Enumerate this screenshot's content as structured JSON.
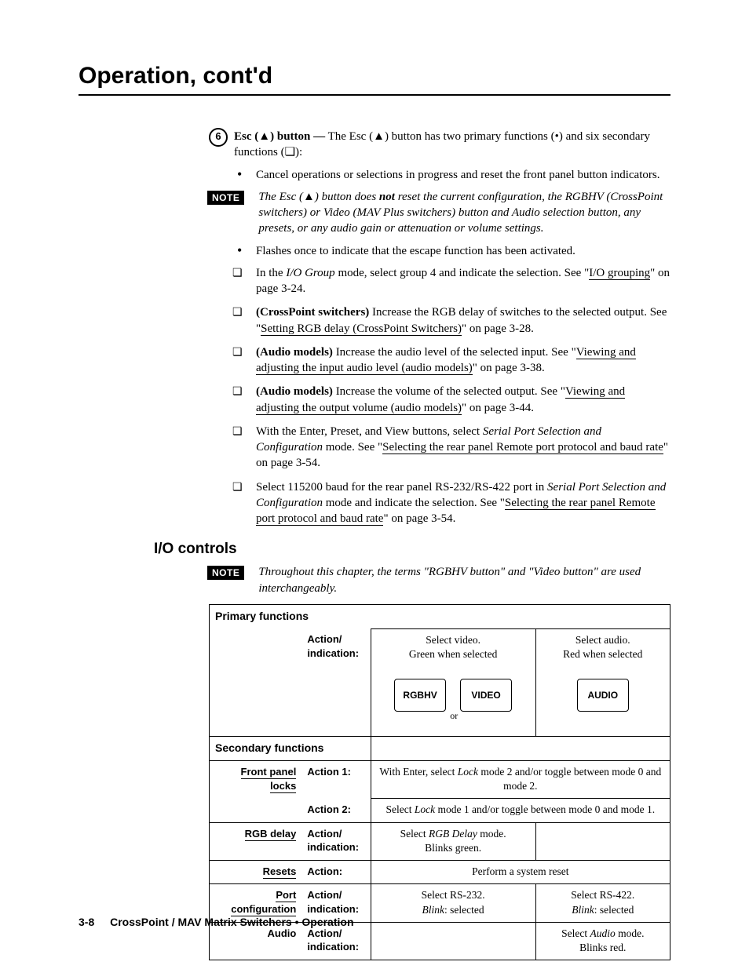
{
  "page_title": "Operation, cont'd",
  "callout_number": "6",
  "intro": "Esc (▲) button — The Esc (▲) button has two primary functions (•) and six secondary functions (❏):",
  "primary_bullet_1": "Cancel operations or selections in progress and reset the front panel button indicators.",
  "note1_label": "NOTE",
  "note1_pre": "The Esc (▲) button does ",
  "note1_not": "not",
  "note1_post": " reset the current configuration, the RGBHV (CrossPoint switchers) or Video (MAV Plus switchers) button and Audio selection button, any presets, or any audio gain or attenuation or volume settings.",
  "primary_bullet_2": "Flashes once to indicate that the escape function has been activated.",
  "sec1_pre": "In the ",
  "sec1_em": "I/O Group",
  "sec1_mid": " mode, select group 4 and indicate the selection. See \"",
  "sec1_link": "I/O grouping",
  "sec1_post": "\" on page 3-24.",
  "sec2_b": "(CrossPoint switchers)",
  "sec2_mid": " Increase the RGB delay of switches to the selected output.  See \"",
  "sec2_link": "Setting RGB delay (CrossPoint Switchers)",
  "sec2_post": "\" on page 3-28.",
  "sec3_b": "(Audio models)",
  "sec3_mid": " Increase the audio level of the selected input. See \"",
  "sec3_link": "Viewing and adjusting the input audio level (audio models)",
  "sec3_post": "\" on page 3-38.",
  "sec4_b": "(Audio models)",
  "sec4_mid": " Increase the volume of the selected output. See \"",
  "sec4_link": "Viewing and adjusting the output volume (audio models)",
  "sec4_post": "\" on page 3-44.",
  "sec5_pre": "With the Enter, Preset, and View buttons, select ",
  "sec5_em": "Serial Port Selection and Configuration",
  "sec5_mid": " mode.  See \"",
  "sec5_link": "Selecting the rear panel Remote port protocol and baud rate",
  "sec5_post": "\" on page 3-54.",
  "sec6_pre": "Select 115200 baud for the rear panel RS-232/RS-422 port in ",
  "sec6_em": "Serial Port Selection and Configuration",
  "sec6_mid": " mode and indicate the selection.  See \"",
  "sec6_link": "Selecting the rear panel Remote port protocol and baud rate",
  "sec6_post": "\" on page 3-54.",
  "section_heading": "I/O controls",
  "note2_label": "NOTE",
  "note2_text": "Throughout this chapter, the terms \"RGBHV button\" and \"Video button\" are used interchangeably.",
  "table": {
    "primary_hdr": "Primary functions",
    "action_indication": "Action/\nindication:",
    "sel_video_a": "Select video.",
    "sel_video_b": "Green when selected",
    "sel_audio_a": "Select audio.",
    "sel_audio_b": "Red when selected",
    "btn_rgbhv": "RGBHV",
    "btn_video": "VIDEO",
    "btn_or": "or",
    "btn_audio": "AUDIO",
    "secondary_hdr": "Secondary functions",
    "row_fpl": "Front panel\nlocks",
    "action1": "Action 1:",
    "fpl1_a": "With Enter, select ",
    "fpl1_em": "Lock",
    "fpl1_b": " mode 2 and/or toggle between mode 0 and mode 2.",
    "action2": "Action 2:",
    "fpl2_a": "Select ",
    "fpl2_em": "Lock",
    "fpl2_b": " mode 1 and/or toggle between mode 0 and mode 1.",
    "row_rgb": "RGB delay",
    "rgb_a": "Select ",
    "rgb_em": "RGB Delay",
    "rgb_b": " mode.",
    "rgb_c": "Blinks green.",
    "row_resets": "Resets",
    "action_only": "Action:",
    "resets_a": "Perform a system reset",
    "row_port": "Port\nconfiguration",
    "port_a1": "Select RS-232.",
    "port_a2_em": "Blink",
    "port_a2": ": selected",
    "port_b1": "Select RS-422.",
    "row_audio": "Audio",
    "audio_a": "Select ",
    "audio_em": "Audio",
    "audio_b": " mode.",
    "audio_c": "Blinks red."
  },
  "footer_page": "3-8",
  "footer_title": "CrossPoint / MAV Matrix Switchers • Operation"
}
